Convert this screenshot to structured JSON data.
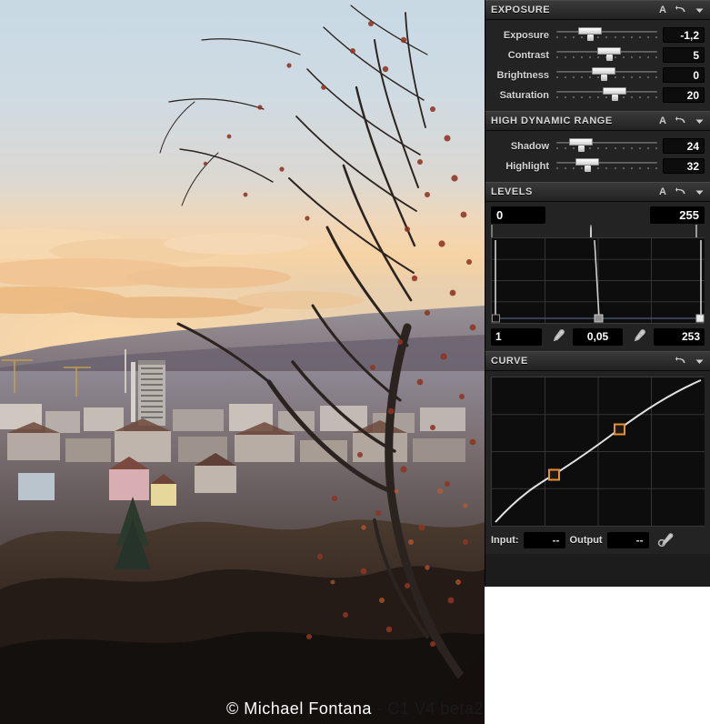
{
  "app": {
    "footer_credit": "© Michael Fontana",
    "footer_version": " - C1 V4 beta2"
  },
  "panel": {
    "sections": [
      {
        "id": "exposure",
        "title": "EXPOSURE",
        "auto_label": "A",
        "reset_icon": "reset-arrow-icon",
        "collapse_icon": "chevron-down-icon",
        "sliders": [
          {
            "label": "Exposure",
            "value": "-1,2",
            "pos": 33
          },
          {
            "label": "Contrast",
            "value": "5",
            "pos": 52
          },
          {
            "label": "Brightness",
            "value": "0",
            "pos": 47
          },
          {
            "label": "Saturation",
            "value": "20",
            "pos": 58
          }
        ]
      },
      {
        "id": "hdr",
        "title": "HIGH DYNAMIC RANGE",
        "auto_label": "A",
        "reset_icon": "reset-arrow-icon",
        "collapse_icon": "chevron-down-icon",
        "sliders": [
          {
            "label": "Shadow",
            "value": "24",
            "pos": 24
          },
          {
            "label": "Highlight",
            "value": "32",
            "pos": 31
          }
        ]
      },
      {
        "id": "levels",
        "title": "LEVELS",
        "auto_label": "A",
        "reset_icon": "reset-arrow-icon",
        "collapse_icon": "chevron-down-icon"
      },
      {
        "id": "curve",
        "title": "CURVE",
        "reset_icon": "reset-arrow-icon",
        "collapse_icon": "chevron-down-icon"
      }
    ]
  },
  "levels": {
    "input_black": "0",
    "input_white": "255",
    "output_black": "1",
    "gamma": "0,05",
    "output_white": "253",
    "handle_black_pos": 1,
    "handle_mid_pos": 48,
    "handle_white_pos": 99,
    "eyedropper_left_icon": "eyedropper-icon",
    "eyedropper_right_icon": "eyedropper-icon"
  },
  "curve": {
    "input_label": "Input:",
    "output_label": "Output",
    "input_value": "--",
    "output_value": "--",
    "eyedropper_icon": "eyedropper-icon"
  },
  "chart_data": [
    {
      "type": "line",
      "title": "LEVELS",
      "xlabel": "",
      "ylabel": "",
      "xlim": [
        0,
        255
      ],
      "ylim": [
        0,
        255
      ],
      "grid": true,
      "x": [
        1,
        122,
        124,
        253
      ],
      "y": [
        0,
        255,
        0,
        255
      ],
      "annotations": [
        {
          "name": "black-point",
          "x": 1,
          "value": "1"
        },
        {
          "name": "gamma-point",
          "x": 122,
          "value": "0,05"
        },
        {
          "name": "white-point",
          "x": 253,
          "value": "253"
        },
        {
          "name": "input-black",
          "value": "0"
        },
        {
          "name": "input-white",
          "value": "255"
        }
      ]
    },
    {
      "type": "line",
      "title": "CURVE",
      "xlabel": "Input",
      "ylabel": "Output",
      "xlim": [
        0,
        255
      ],
      "ylim": [
        0,
        255
      ],
      "grid": true,
      "x": [
        0,
        32,
        64,
        96,
        128,
        160,
        192,
        224,
        255
      ],
      "y": [
        0,
        46,
        86,
        118,
        144,
        170,
        197,
        226,
        255
      ],
      "control_points": [
        {
          "name": "shadow-control-point",
          "x": 74,
          "y": 104
        },
        {
          "name": "highlight-control-point",
          "x": 176,
          "y": 182
        }
      ],
      "legend": []
    }
  ]
}
